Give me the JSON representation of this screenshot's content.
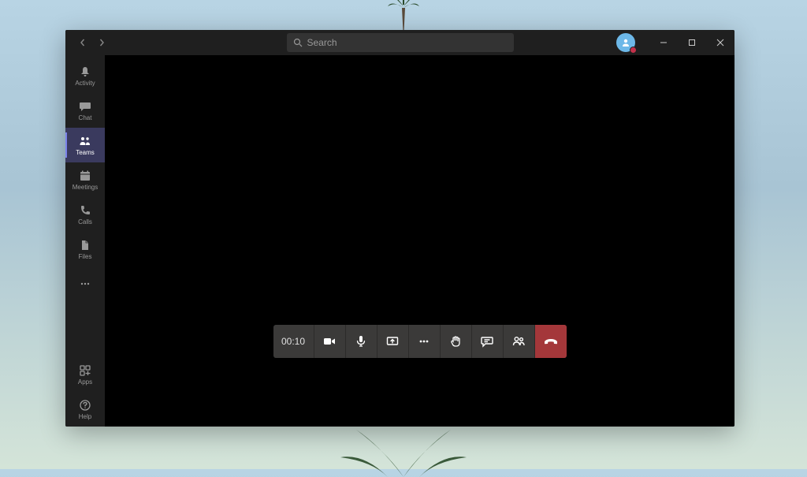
{
  "search": {
    "placeholder": "Search"
  },
  "sidebar": {
    "items": [
      {
        "id": "activity",
        "label": "Activity"
      },
      {
        "id": "chat",
        "label": "Chat"
      },
      {
        "id": "teams",
        "label": "Teams"
      },
      {
        "id": "meetings",
        "label": "Meetings"
      },
      {
        "id": "calls",
        "label": "Calls"
      },
      {
        "id": "files",
        "label": "Files"
      }
    ],
    "active": "teams",
    "bottom": [
      {
        "id": "apps",
        "label": "Apps"
      },
      {
        "id": "help",
        "label": "Help"
      }
    ]
  },
  "call": {
    "timer": "00:10",
    "buttons": [
      {
        "id": "camera",
        "name": "camera"
      },
      {
        "id": "mic",
        "name": "microphone"
      },
      {
        "id": "share",
        "name": "share-screen"
      },
      {
        "id": "more",
        "name": "more-actions"
      },
      {
        "id": "raise-hand",
        "name": "raise-hand"
      },
      {
        "id": "chat",
        "name": "show-conversation"
      },
      {
        "id": "participants",
        "name": "participants"
      },
      {
        "id": "hangup",
        "name": "hang-up"
      }
    ]
  },
  "user": {
    "status": "busy"
  }
}
